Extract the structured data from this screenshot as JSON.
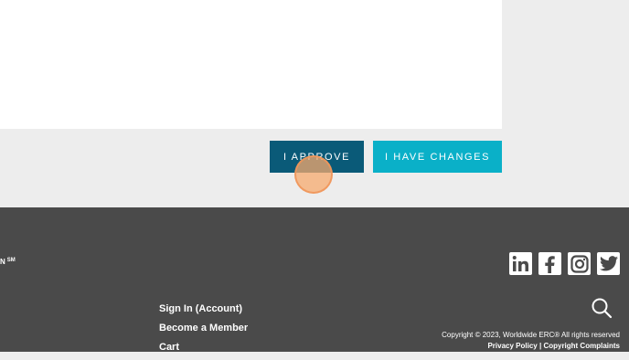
{
  "actions": {
    "approve_label": "I APPROVE",
    "changes_label": "I HAVE CHANGES"
  },
  "footer": {
    "brand_fragment": "N",
    "brand_mark": "SM",
    "links": [
      "Sign In (Account)",
      "Become a Member",
      "Cart"
    ],
    "social_icons": [
      "linkedin-icon",
      "facebook-icon",
      "instagram-icon",
      "twitter-icon"
    ],
    "copyright": "Copyright © 2023, Worldwide ERC® All rights reserved",
    "privacy": "Privacy Policy",
    "separator": "|",
    "copyright_complaints": "Copyright Complaints"
  },
  "colors": {
    "approve_bg": "#0a5a78",
    "changes_bg": "#0ab0c8",
    "footer_bg": "#4a4a4a",
    "page_bg": "#ededed"
  }
}
